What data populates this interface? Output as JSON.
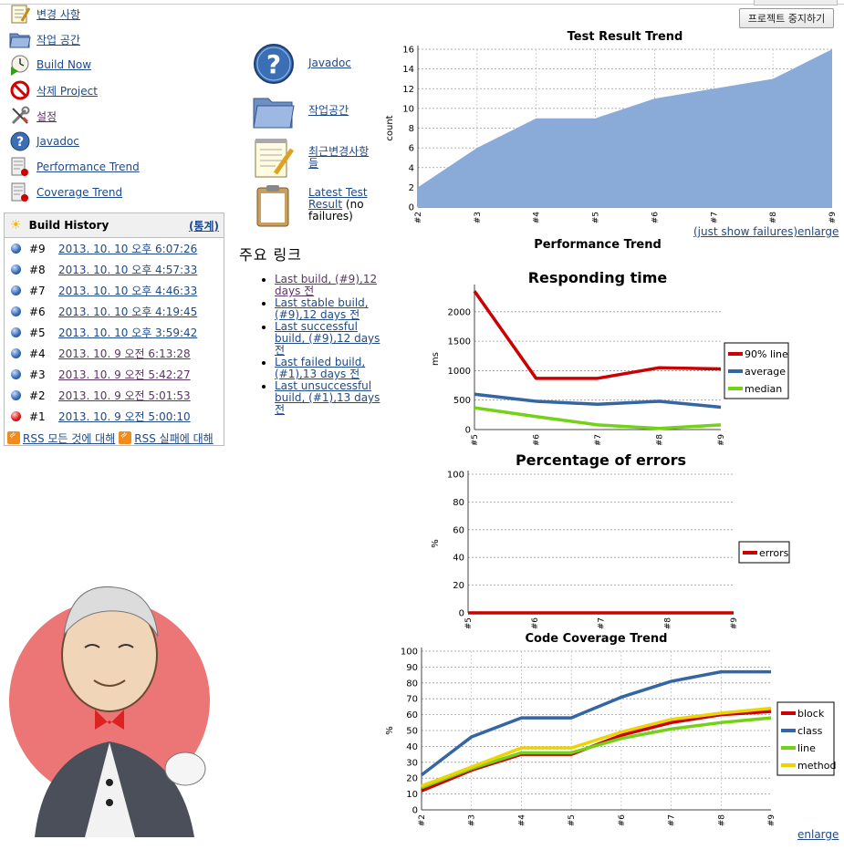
{
  "top": {
    "disable_button": "프로젝트 중지하기"
  },
  "tasks": [
    {
      "label": "변경 사항",
      "icon": "notepad-icon"
    },
    {
      "label": "작업 공간",
      "icon": "folder-icon"
    },
    {
      "label": "Build Now",
      "icon": "clock-play-icon"
    },
    {
      "label": "삭제 Project",
      "icon": "no-entry-icon"
    },
    {
      "label": "설정",
      "icon": "wrench-screwdriver-icon"
    },
    {
      "label": "Javadoc",
      "icon": "help-icon"
    },
    {
      "label": "Performance Trend",
      "icon": "graph-icon"
    },
    {
      "label": "Coverage Trend",
      "icon": "graph-icon"
    }
  ],
  "build_history": {
    "title": "Build History",
    "trend_link": "(통계)",
    "rows": [
      {
        "num": "#9",
        "date": "2013. 10. 10 오후 6:07:26",
        "status": "blue"
      },
      {
        "num": "#8",
        "date": "2013. 10. 10 오후 4:57:33",
        "status": "blue"
      },
      {
        "num": "#7",
        "date": "2013. 10. 10 오후 4:46:33",
        "status": "blue"
      },
      {
        "num": "#6",
        "date": "2013. 10. 10 오후 4:19:45",
        "status": "blue"
      },
      {
        "num": "#5",
        "date": "2013. 10. 10 오후 3:59:42",
        "status": "blue"
      },
      {
        "num": "#4",
        "date": "2013. 10. 9 오전 6:13:28",
        "status": "blue"
      },
      {
        "num": "#3",
        "date": "2013. 10. 9 오전 5:42:27",
        "status": "blue"
      },
      {
        "num": "#2",
        "date": "2013. 10. 9 오전 5:01:53",
        "status": "blue"
      },
      {
        "num": "#1",
        "date": "2013. 10. 9 오전 5:00:10",
        "status": "red"
      }
    ],
    "rss_all": "RSS 모든 것에 대해",
    "rss_failed": "RSS 실패에 대해"
  },
  "main_links": {
    "javadoc": "Javadoc",
    "workspace": "작업공간",
    "changes": "최근변경사항 들",
    "test_result_link": "Latest Test Result",
    "test_result_note": "(no failures)"
  },
  "permalinks": {
    "title": "주요 링크",
    "items": [
      "Last build, (#9),12 days 전",
      "Last stable build, (#9),12 days 전",
      "Last successful build, (#9),12 days 전",
      "Last failed build, (#1),13 days 전",
      "Last unsuccessful build, (#1),13 days 전"
    ]
  },
  "links": {
    "just_show_failures": "(just show failures)",
    "enlarge": "enlarge",
    "enlarge2": "enlarge"
  },
  "chart_data": [
    {
      "type": "area",
      "title": "Test Result Trend",
      "xlabel": "",
      "ylabel": "count",
      "categories": [
        "#2",
        "#3",
        "#4",
        "#5",
        "#6",
        "#7",
        "#8",
        "#9"
      ],
      "series": [
        {
          "values": [
            2,
            6,
            9,
            9,
            11,
            12,
            13,
            16
          ]
        }
      ],
      "ylim": [
        0,
        16
      ],
      "yticks": [
        0,
        2,
        4,
        6,
        8,
        10,
        12,
        14,
        16
      ],
      "color": "#8aaad8",
      "grid": true
    },
    {
      "type": "line",
      "section_title": "Performance Trend",
      "title": "Responding time",
      "xlabel": "",
      "ylabel": "ms",
      "categories": [
        "#5",
        "#6",
        "#7",
        "#8",
        "#9"
      ],
      "series": [
        {
          "name": "90% line",
          "values": [
            2350,
            870,
            870,
            1050,
            1030
          ],
          "color": "#cc0000"
        },
        {
          "name": "average",
          "values": [
            600,
            480,
            430,
            480,
            380
          ],
          "color": "#3465a4"
        },
        {
          "name": "median",
          "values": [
            370,
            220,
            80,
            20,
            80
          ],
          "color": "#73d216"
        }
      ],
      "ylim": [
        0,
        2400
      ],
      "yticks": [
        0,
        500,
        1000,
        1500,
        2000
      ],
      "legend": "right",
      "grid": true
    },
    {
      "type": "line",
      "title": "Percentage of errors",
      "xlabel": "",
      "ylabel": "%",
      "categories": [
        "#5",
        "#6",
        "#7",
        "#8",
        "#9"
      ],
      "series": [
        {
          "name": "errors",
          "values": [
            0,
            0,
            0,
            0,
            0
          ],
          "color": "#cc0000"
        }
      ],
      "ylim": [
        0,
        100
      ],
      "yticks": [
        0,
        20,
        40,
        60,
        80,
        100
      ],
      "legend": "right",
      "grid": true
    },
    {
      "type": "line",
      "title": "Code Coverage Trend",
      "xlabel": "",
      "ylabel": "%",
      "categories": [
        "#2",
        "#3",
        "#4",
        "#5",
        "#6",
        "#7",
        "#8",
        "#9"
      ],
      "series": [
        {
          "name": "block",
          "values": [
            12,
            25,
            35,
            35,
            47,
            55,
            60,
            62
          ],
          "color": "#cc0000"
        },
        {
          "name": "class",
          "values": [
            22,
            46,
            58,
            58,
            71,
            81,
            87,
            87
          ],
          "color": "#3465a4"
        },
        {
          "name": "line",
          "values": [
            14,
            26,
            36,
            36,
            45,
            51,
            55,
            58
          ],
          "color": "#73d216"
        },
        {
          "name": "method",
          "values": [
            15,
            27,
            39,
            39,
            49,
            57,
            61,
            64
          ],
          "color": "#edd400"
        }
      ],
      "ylim": [
        0,
        100
      ],
      "yticks": [
        0,
        10,
        20,
        30,
        40,
        50,
        60,
        70,
        80,
        90,
        100
      ],
      "legend": "right",
      "grid": true
    }
  ]
}
